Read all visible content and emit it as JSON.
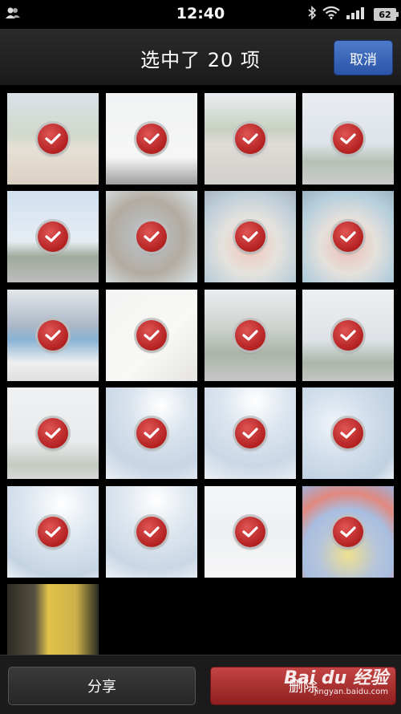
{
  "status_bar": {
    "time": "12:40",
    "battery": "62"
  },
  "header": {
    "title": "选中了 20 项",
    "cancel_label": "取消"
  },
  "thumbnails": [
    {
      "bg": "linear-gradient(#c8d2dc 0%,#b8c4b0 45%,#d8cfc0 60%,#c9b9a3 100%)"
    },
    {
      "bg": "linear-gradient(#e8ecee 0%,#f2f2f2 70%,#6a6a6a 100%)"
    },
    {
      "bg": "linear-gradient(#dfe4ea 0%,#a9b8a0 40%,#cfc9c2 55%,#b9b6b0 100%)"
    },
    {
      "bg": "linear-gradient(#dde3ea 0%,#ccd5de 55%,#8ea08e 75%,#b0b0b0 100%)"
    },
    {
      "bg": "linear-gradient(#b9d0e6 0%,#d9e4ee 55%,#6d7d68 72%,#9a9a9a 100%)"
    },
    {
      "bg": "radial-gradient(circle at 45% 50%,#9aa7b5 0%,#8a7f70 55%,#c8d7e0 100%)"
    },
    {
      "bg": "radial-gradient(circle at 50% 60%,#e8a893 0%,#d7d3cc 40%,#9bb4c3 75%,#7a8ea0 100%)"
    },
    {
      "bg": "radial-gradient(circle at 50% 60%,#e59a8a 0%,#d6d0c9 40%,#8ab3c9 75%,#6e8ba0 100%)"
    },
    {
      "bg": "linear-gradient(#d7dbe0 0%,#7d90a8 40%,#4a8ac0 55%,#e7e7e7 80%,#cfcfcf 100%)"
    },
    {
      "bg": "linear-gradient(135deg,#eeeeee 0%,#f4f4f0 60%,#d8d6d0 100%)"
    },
    {
      "bg": "linear-gradient(#dfe3e8 0%,#b6bdb6 40%,#7d8d7a 70%,#a9a9a9 100%)"
    },
    {
      "bg": "linear-gradient(#e4e8ec 0%,#cdd4da 55%,#7e8f7a 80%,#a6a6a6 100%)"
    },
    {
      "bg": "linear-gradient(#e7eaed 0%,#dcdfe2 60%,#a5b0a0 85%,#c2c2c2 100%)"
    },
    {
      "bg": "radial-gradient(circle at 60% 20%,#ffffff 0%,#c5d4e3 35%,#a9bfd6 70%,#dfe6ee 100%)"
    },
    {
      "bg": "radial-gradient(circle at 55% 15%,#ffffff 0%,#cad8e6 35%,#aec3d8 70%,#e2e8ef 100%)"
    },
    {
      "bg": "radial-gradient(circle at 35% 40%,#e7eef6 0%,#b7cbe0 45%,#9fb8d2 80%,#dde5ee 100%)"
    },
    {
      "bg": "radial-gradient(circle at 60% 20%,#ffffff 0%,#cbd9e7 40%,#a6bdd5 80%,#e0e7ef 100%)"
    },
    {
      "bg": "radial-gradient(circle at 55% 15%,#ffffff 0%,#d0dce8 35%,#adc2d7 75%,#e3e9f0 100%)"
    },
    {
      "bg": "linear-gradient(#f0f2f4 0%,#e4e8ec 50%,#f3f3f3 100%)"
    },
    {
      "bg": "radial-gradient(circle at 50% 75%,#e6cf55 0%,#8fa6c6 35%,#7a9bd0 55%,#d24a3a 75%,#6b86c4 100%)"
    },
    {
      "bg": "linear-gradient(90deg,#2b2b22 0%,#575040 30%,#e0c24a 45%,#cdb14a 75%,#2a2a24 100%)"
    }
  ],
  "actions": {
    "share_label": "分享",
    "delete_label": "删除"
  },
  "watermark": {
    "logo": "Bai du 经验",
    "url": "jingyan.baidu.com"
  }
}
